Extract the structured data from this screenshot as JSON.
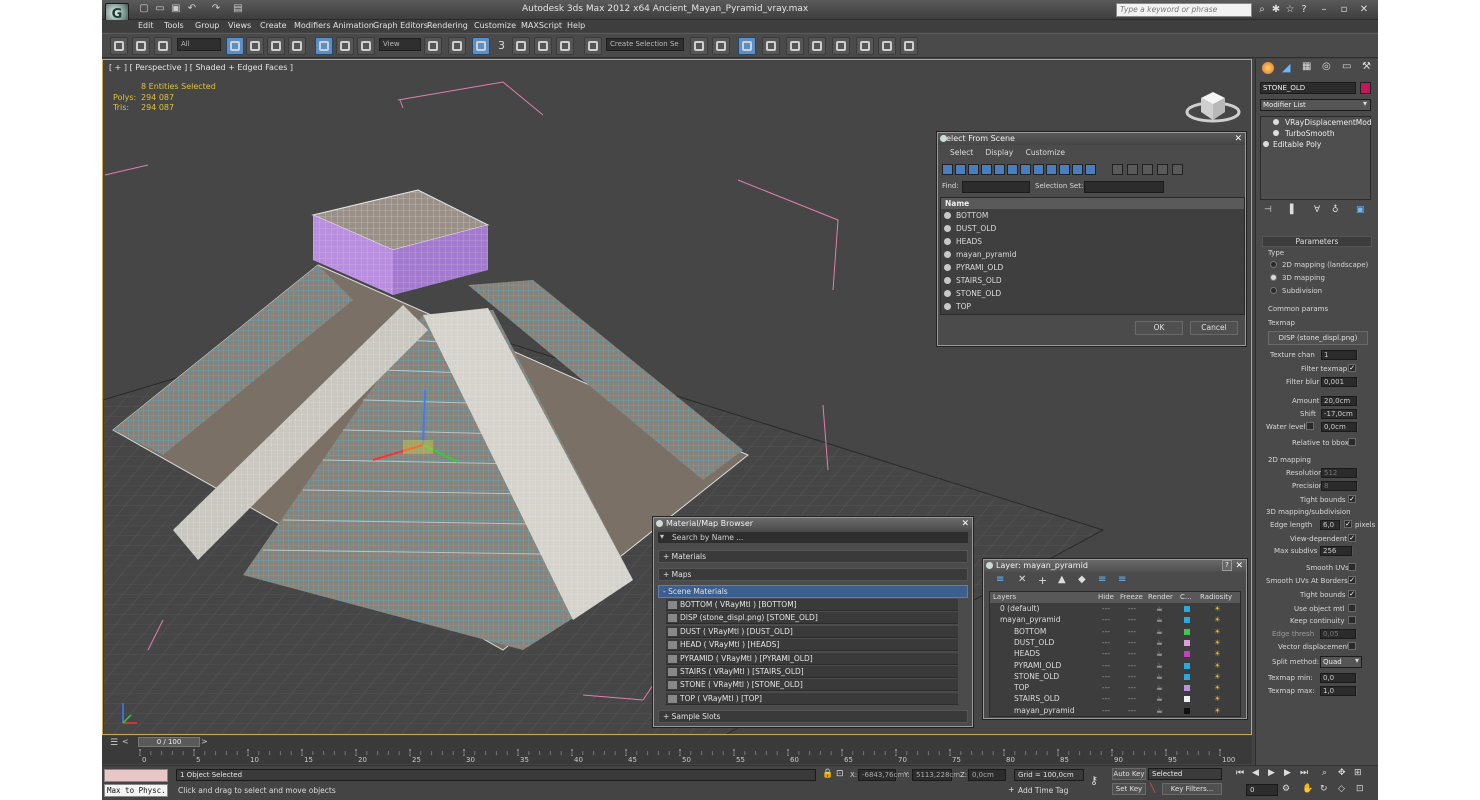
{
  "app": {
    "title": "Autodesk 3ds Max  2012 x64      Ancient_Mayan_Pyramid_vray.max",
    "logo": "3ds Max logo",
    "search_placeholder": "Type a keyword or phrase"
  },
  "menu": [
    "Edit",
    "Tools",
    "Group",
    "Views",
    "Create",
    "Modifiers",
    "Animation",
    "Graph Editors",
    "Rendering",
    "Customize",
    "MAXScript",
    "Help"
  ],
  "toolbar": {
    "filter_value": "All",
    "coord_value": "View",
    "snap_label": "3",
    "selection_set_placeholder": "Create Selection Se"
  },
  "viewport": {
    "label": "[ + ] [ Perspective ] [ Shaded + Edged Faces ]",
    "entities": "8 Entities Selected",
    "polys_label": "Polys:",
    "polys_value": "294 087",
    "tris_label": "Tris:",
    "tris_value": "294 087"
  },
  "select_from_scene": {
    "title": "Select From Scene",
    "menus": [
      "Select",
      "Display",
      "Customize"
    ],
    "find_label": "Find:",
    "selection_set_label": "Selection Set:",
    "column_name": "Name",
    "rows": [
      "BOTTOM",
      "DUST_OLD",
      "HEADS",
      "mayan_pyramid",
      "PYRAMI_OLD",
      "STAIRS_OLD",
      "STONE_OLD",
      "TOP"
    ],
    "ok": "OK",
    "cancel": "Cancel"
  },
  "material_browser": {
    "title": "Material/Map Browser",
    "search": "Search by Name ...",
    "sections": [
      "+ Materials",
      "+ Maps",
      "- Scene Materials"
    ],
    "materials": [
      "BOTTOM  ( VRayMtl )  [BOTTOM]",
      "DISP (stone_displ.png)  [STONE_OLD]",
      "DUST  ( VRayMtl )  [DUST_OLD]",
      "HEAD  ( VRayMtl )  [HEADS]",
      "PYRAMID  ( VRayMtl )  [PYRAMI_OLD]",
      "STAIRS  ( VRayMtl )  [STAIRS_OLD]",
      "STONE  ( VRayMtl )  [STONE_OLD]",
      "TOP  ( VRayMtl )  [TOP]"
    ],
    "sample_slots": "+ Sample Slots"
  },
  "layer_dialog": {
    "title": "Layer: mayan_pyramid",
    "help": "?",
    "columns": [
      "Layers",
      "Hide",
      "Freeze",
      "Render",
      "C...",
      "Radiosity"
    ],
    "rows": [
      {
        "name": "0 (default)",
        "color": "#2aa8e0",
        "indent": 0
      },
      {
        "name": "mayan_pyramid",
        "color": "#2aa8e0",
        "indent": 0
      },
      {
        "name": "BOTTOM",
        "color": "#45c24a",
        "indent": 1
      },
      {
        "name": "DUST_OLD",
        "color": "#d8a0d8",
        "indent": 1
      },
      {
        "name": "HEADS",
        "color": "#c040c0",
        "indent": 1
      },
      {
        "name": "PYRAMI_OLD",
        "color": "#2aa8e0",
        "indent": 1
      },
      {
        "name": "STONE_OLD",
        "color": "#2aa8e0",
        "indent": 1
      },
      {
        "name": "TOP",
        "color": "#c090e0",
        "indent": 1
      },
      {
        "name": "STAIRS_OLD",
        "color": "#f0f0f0",
        "indent": 1
      },
      {
        "name": "mayan_pyramid",
        "color": "#111111",
        "indent": 1
      }
    ]
  },
  "command_panel": {
    "object_name": "STONE_OLD",
    "object_color": "#c2185b",
    "modifier_list": "Modifier List",
    "stack": [
      "VRayDisplacementMod",
      "TurboSmooth",
      "Editable Poly"
    ],
    "params_title": "Parameters",
    "type_label": "Type",
    "types": [
      "2D mapping (landscape)",
      "3D mapping",
      "Subdivision"
    ],
    "common_params": "Common params",
    "texmap_label": "Texmap",
    "texmap_button": "DISP (stone_displ.png)",
    "texture_chan_label": "Texture chan",
    "texture_chan": "1",
    "filter_texmap": "Filter texmap",
    "filter_blur_label": "Filter blur",
    "filter_blur": "0,001",
    "amount_label": "Amount",
    "amount": "20,0cm",
    "shift_label": "Shift",
    "shift": "-17,0cm",
    "water_level_label": "Water level",
    "water_level": "0,0cm",
    "relative_bbox": "Relative to bbox",
    "mapping2d": "2D mapping",
    "resolution_label": "Resolution",
    "resolution": "512",
    "precision_label": "Precision",
    "precision": "8",
    "tight_bounds_2d": "Tight bounds",
    "mapping3d": "3D mapping/subdivision",
    "edge_length_label": "Edge length",
    "edge_length": "6,0",
    "pixels": "pixels",
    "view_dependent": "View-dependent",
    "max_subdivs_label": "Max subdivs",
    "max_subdivs": "256",
    "smooth_uvs": "Smooth UVs",
    "smooth_uvs_borders": "Smooth UVs At Borders",
    "tight_bounds": "Tight bounds",
    "use_object_mtl": "Use object mtl",
    "keep_continuity": "Keep continuity",
    "edge_thresh_label": "Edge thresh",
    "edge_thresh": "0,05",
    "vector_displacement": "Vector displacement",
    "split_method_label": "Split method:",
    "split_method": "Quad",
    "texmap_min_label": "Texmap min:",
    "texmap_min": "0,0",
    "texmap_max_label": "Texmap max:",
    "texmap_max": "1,0"
  },
  "timeline": {
    "frame": "0 / 100",
    "ticks": [
      "0",
      "5",
      "10",
      "15",
      "20",
      "25",
      "30",
      "35",
      "40",
      "45",
      "50",
      "55",
      "60",
      "65",
      "70",
      "75",
      "80",
      "85",
      "90",
      "95",
      "100"
    ]
  },
  "status": {
    "script": "Max to Physc.",
    "selected": "1 Object Selected",
    "prompt": "Click and drag to select and move objects",
    "x_label": "X:",
    "x": "-6843,76cm",
    "y_label": "Y:",
    "y": "5113,228cm",
    "z_label": "Z:",
    "z": "0,0cm",
    "grid": "Grid = 100,0cm",
    "add_time_tag": "Add Time Tag",
    "auto_key": "Auto Key",
    "set_key": "Set Key",
    "key_mode": "Selected",
    "key_filters": "Key Filters...",
    "frame": "0"
  }
}
